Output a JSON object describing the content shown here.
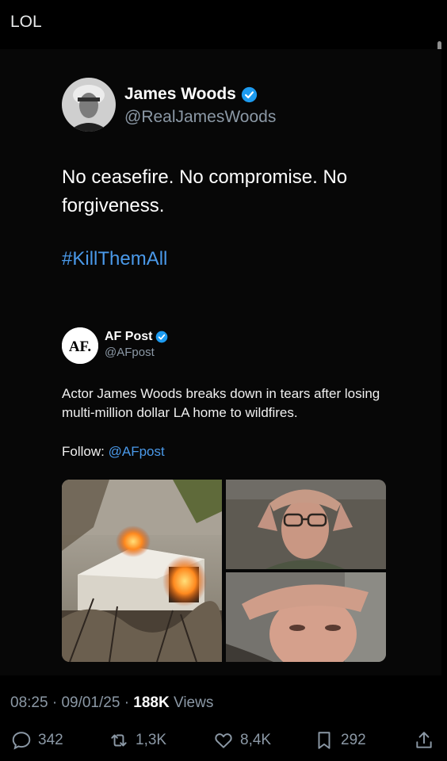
{
  "post": {
    "text": "LOL"
  },
  "quoted_tweet": {
    "author_name": "James Woods",
    "author_handle": "@RealJamesWoods",
    "verified": true,
    "text": "No ceasefire. No compromise. No forgiveness.",
    "hashtag": "#KillThemAll",
    "embedded": {
      "avatar_text": "AF.",
      "author_name": "AF Post",
      "author_handle": "@AFpost",
      "verified": true,
      "text": "Actor James Woods breaks down in tears after losing multi-million dollar LA home to wildfires.",
      "follow_label": "Follow:",
      "follow_mention": "@AFpost"
    }
  },
  "meta": {
    "time": "08:25",
    "date": "09/01/25",
    "views_count": "188K",
    "views_label": "Views"
  },
  "actions": {
    "replies": "342",
    "reposts": "1,3K",
    "likes": "8,4K",
    "bookmarks": "292"
  },
  "icons": [
    "reply-icon",
    "repost-icon",
    "like-icon",
    "bookmark-icon",
    "share-icon",
    "verified-badge-icon"
  ],
  "colors": {
    "background": "#000000",
    "text": "#e7e9ea",
    "secondary": "#8b98a5",
    "link": "#4a99e9",
    "verified": "#1d9bf0"
  }
}
